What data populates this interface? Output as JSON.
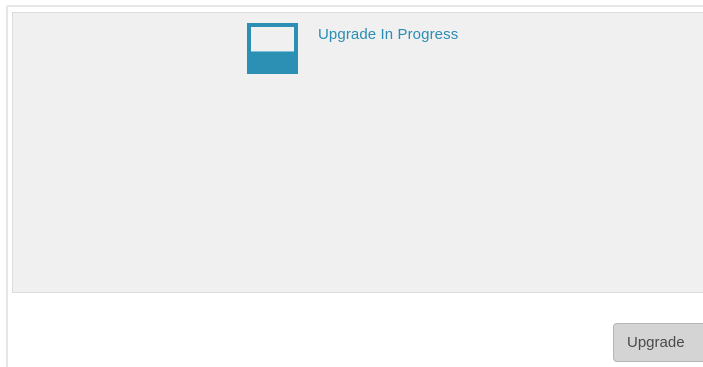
{
  "status": {
    "title": "Upgrade In Progress",
    "icon": "monitor-progress-icon",
    "accent_color": "#2c8fb4"
  },
  "actions": {
    "upgrade_label": "Upgrade",
    "upgrade_disabled": true
  }
}
